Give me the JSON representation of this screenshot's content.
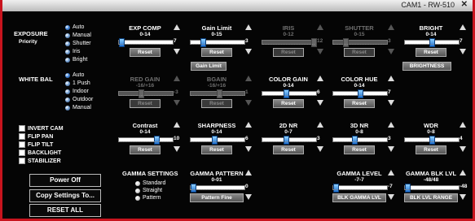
{
  "window": {
    "title": "CAM1 - RW-510",
    "close": "✕"
  },
  "exposure": {
    "label": "EXPOSURE",
    "sublabel": "Priority",
    "options": [
      "Auto",
      "Manual",
      "Shutter",
      "Iris",
      "Bright"
    ],
    "selected": "Auto"
  },
  "white_bal": {
    "label": "WHITE BAL",
    "options": [
      "Auto",
      "1 Push",
      "Indoor",
      "Outdoor",
      "Manual"
    ],
    "selected": "Auto"
  },
  "checkboxes": [
    "INVERT CAM",
    "FLIP PAN",
    "FLIP TILT",
    "BACKLIGHT",
    "STABILIZER"
  ],
  "buttons": {
    "power_off": "Power Off",
    "copy_settings": "Copy Settings To...",
    "reset_all": "RESET ALL"
  },
  "controls": {
    "exp_comp": {
      "name": "EXP COMP",
      "range": "0-14",
      "value": "7",
      "reset": "Reset",
      "level": 0.0,
      "enabled": true
    },
    "gain_limit": {
      "name": "Gain Limit",
      "range": "0-15",
      "value": "3",
      "reset": "Reset",
      "level": 0.2,
      "enabled": true,
      "extra": "Gain Limit"
    },
    "iris": {
      "name": "IRIS",
      "range": "0-12",
      "value": "12",
      "reset": "Reset",
      "level": 1.0,
      "enabled": false
    },
    "shutter": {
      "name": "SHUTTER",
      "range": "0-15",
      "value": "3",
      "reset": "Reset",
      "level": 0.2,
      "enabled": false
    },
    "bright": {
      "name": "BRIGHT",
      "range": "0-14",
      "value": "7",
      "reset": "Reset",
      "level": 0.5,
      "enabled": true,
      "extra": "BRIGHTNESS"
    },
    "red_gain": {
      "name": "RED GAIN",
      "range": "-16/+16",
      "value": "-3",
      "reset": "Reset",
      "level": 0.4,
      "enabled": false
    },
    "bgain": {
      "name": "BGAIN",
      "range": "-16/+16",
      "value": "1",
      "reset": "Reset",
      "level": 0.53,
      "enabled": false
    },
    "color_gain": {
      "name": "COLOR GAIN",
      "range": "0-14",
      "value": "6",
      "reset": "Reset",
      "level": 0.43,
      "enabled": true
    },
    "color_hue": {
      "name": "COLOR HUE",
      "range": "0-14",
      "value": "7",
      "reset": "Reset",
      "level": 0.5,
      "enabled": true
    },
    "contrast": {
      "name": "Contrast",
      "range": "0-14",
      "value": "10",
      "reset": "Reset",
      "level": 0.71,
      "enabled": true
    },
    "sharpness": {
      "name": "SHARPNESS",
      "range": "0-14",
      "value": "6",
      "reset": "Reset",
      "level": 0.43,
      "enabled": true
    },
    "nr2d": {
      "name": "2D NR",
      "range": "0-7",
      "value": "3",
      "reset": "Reset",
      "level": 0.43,
      "enabled": true
    },
    "nr3d": {
      "name": "3D NR",
      "range": "0-8",
      "value": "3",
      "reset": "Reset",
      "level": 0.38,
      "enabled": true
    },
    "wdr": {
      "name": "WDR",
      "range": "0-8",
      "value": "4",
      "reset": "Reset",
      "level": 0.5,
      "enabled": true
    },
    "gamma_pattern": {
      "name": "GAMMA PATTERN",
      "range": "0-01",
      "value": "0",
      "reset": "Pattern Fine",
      "level": 0.0,
      "enabled": true
    },
    "gamma_level": {
      "name": "GAMMA LEVEL",
      "range": "-7-7",
      "value": "-7",
      "reset": "BLK GAMMA LVL",
      "level": 0.0,
      "enabled": true
    },
    "gamma_blk_lvl": {
      "name": "GAMMA BLK LVL",
      "range": "-48/48",
      "value": "-48",
      "reset": "BLK LVL RANGE",
      "level": 0.0,
      "enabled": true
    }
  },
  "gamma_settings": {
    "label": "GAMMA SETTINGS",
    "options": [
      "Standard",
      "Straight",
      "Pattern"
    ],
    "selected": "Straight"
  }
}
